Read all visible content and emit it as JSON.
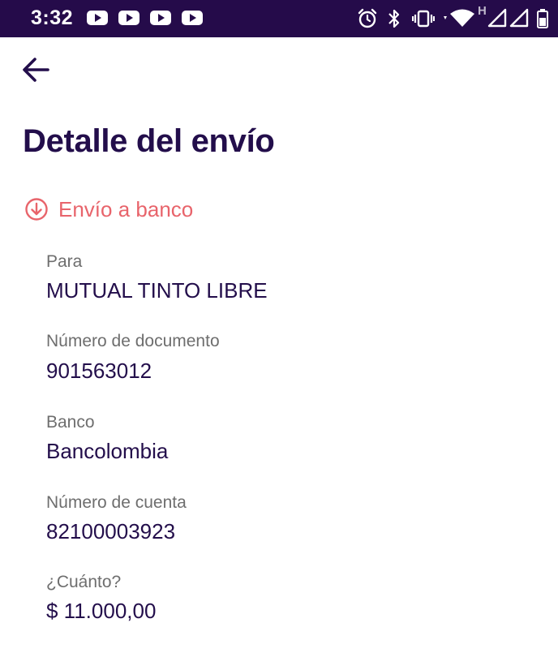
{
  "status_bar": {
    "time": "3:32",
    "notification_icons": [
      "youtube-icon",
      "youtube-icon",
      "youtube-icon",
      "youtube-icon"
    ],
    "system_icons": [
      "alarm-icon",
      "bluetooth-icon",
      "vibrate-icon",
      "wifi-icon",
      "signal-icon",
      "signal-icon",
      "battery-icon"
    ],
    "network_label": "H"
  },
  "header": {
    "back_icon": "arrow-left-icon",
    "title": "Detalle del envío"
  },
  "transfer": {
    "type_icon": "arrow-down-circle-icon",
    "type_label": "Envío a banco",
    "type_color": "#e8646b",
    "fields": [
      {
        "label": "Para",
        "value": "MUTUAL TINTO LIBRE"
      },
      {
        "label": "Número de documento",
        "value": "901563012"
      },
      {
        "label": "Banco",
        "value": "Bancolombia"
      },
      {
        "label": "Número de cuenta",
        "value": "82100003923"
      },
      {
        "label": "¿Cuánto?",
        "value": "$ 11.000,00"
      }
    ]
  },
  "colors": {
    "status_bar_bg": "#250b4a",
    "title": "#230e4b",
    "label": "#6e6e6e"
  }
}
